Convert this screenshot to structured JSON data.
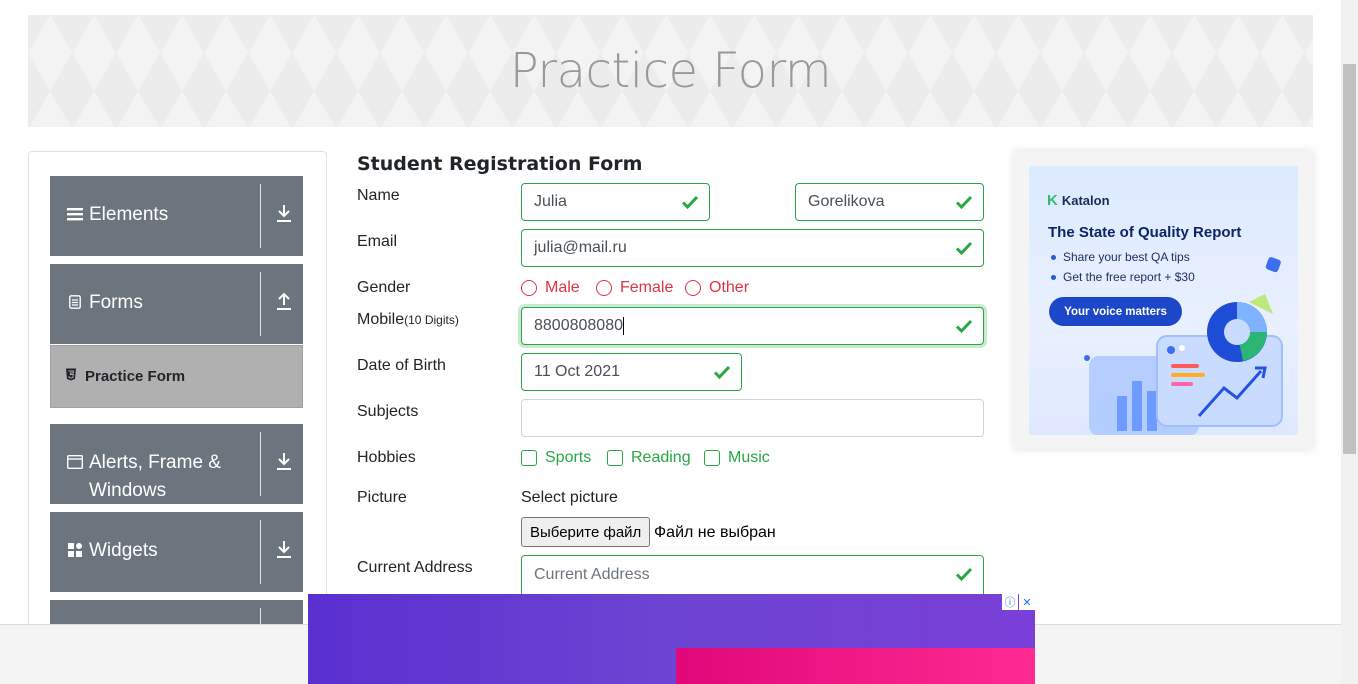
{
  "banner": {
    "title": "Practice Form"
  },
  "sidebar": {
    "groups": [
      {
        "label": "Elements",
        "icon": "menu-icon",
        "expand": "down"
      },
      {
        "label": "Forms",
        "icon": "document-icon",
        "expand": "up"
      },
      {
        "label": "Alerts, Frame & Windows",
        "icon": "window-icon",
        "expand": "down"
      },
      {
        "label": "Widgets",
        "icon": "widgets-icon",
        "expand": "down"
      }
    ],
    "active_item": "Practice Form"
  },
  "form": {
    "title": "Student Registration Form",
    "name_label": "Name",
    "first_name": "Julia",
    "last_name": "Gorelikova",
    "email_label": "Email",
    "email": "julia@mail.ru",
    "gender_label": "Gender",
    "genders": [
      "Male",
      "Female",
      "Other"
    ],
    "mobile_label": "Mobile",
    "mobile_hint": "(10 Digits)",
    "mobile": "8800808080",
    "dob_label": "Date of Birth",
    "dob": "11 Oct 2021",
    "subjects_label": "Subjects",
    "hobbies_label": "Hobbies",
    "hobbies": [
      "Sports",
      "Reading",
      "Music"
    ],
    "picture_label": "Picture",
    "picture_prompt": "Select picture",
    "file_button": "Выберите файл",
    "file_status": "Файл не выбран",
    "address_label": "Current Address",
    "address_placeholder": "Current Address"
  },
  "ad": {
    "brand": "Katalon",
    "title": "The State of Quality Report",
    "bullets": [
      "Share your best QA tips",
      "Get the free report + $30"
    ],
    "cta": "Your voice matters"
  },
  "colors": {
    "valid": "#28a745",
    "invalid": "#dc3545",
    "sidebar": "#6c757d"
  }
}
